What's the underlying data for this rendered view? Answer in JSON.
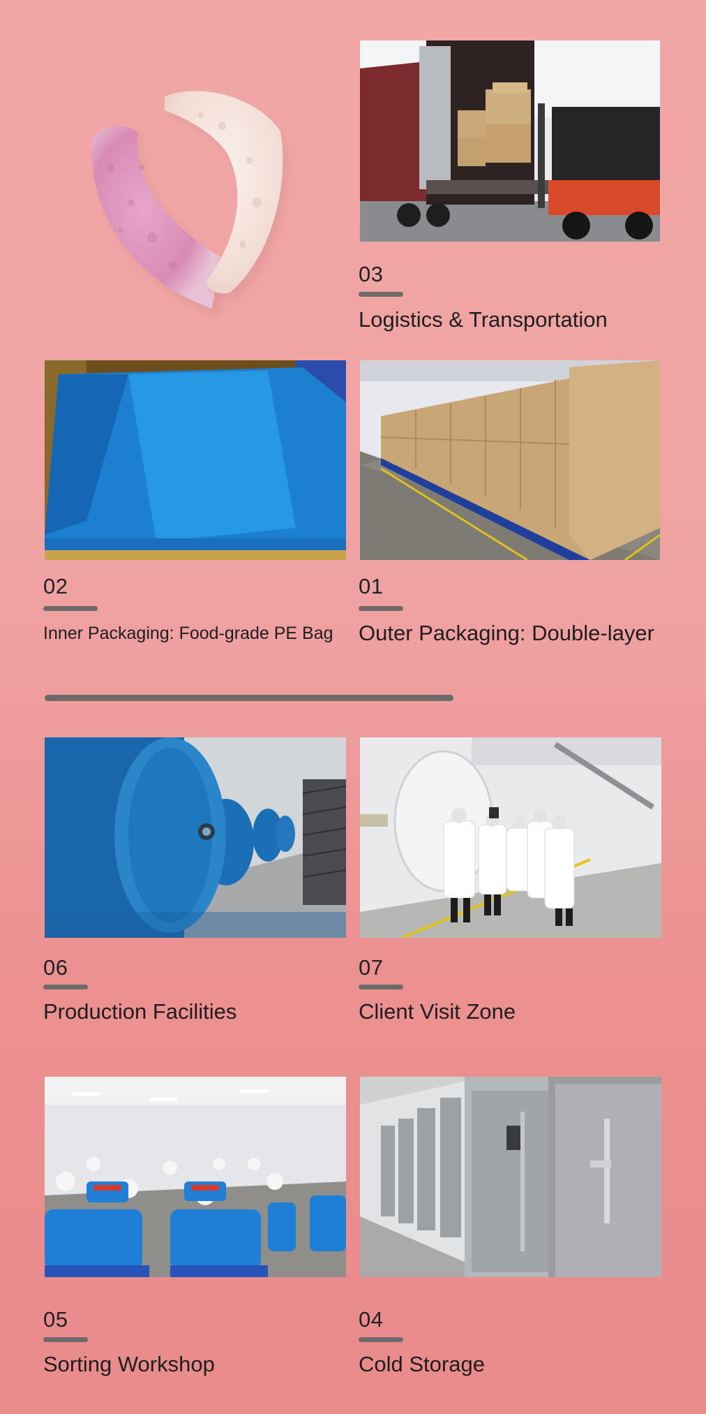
{
  "sections": {
    "logistics": {
      "number": "03",
      "title": "Logistics & Transportation"
    },
    "inner_packaging": {
      "number": "02",
      "title": "Inner Packaging: Food-grade PE Bag"
    },
    "outer_packaging": {
      "number": "01",
      "title": "Outer Packaging: Double-layer"
    },
    "production": {
      "number": "06",
      "title": "Production Facilities"
    },
    "client_visit": {
      "number": "07",
      "title": "Client Visit Zone"
    },
    "sorting": {
      "number": "05",
      "title": "Sorting Workshop"
    },
    "cold_storage": {
      "number": "04",
      "title": "Cold Storage"
    }
  },
  "colors": {
    "background": "#f1a7a6",
    "accent_bar": "#6f6a6a",
    "text": "#1e1e1e"
  }
}
